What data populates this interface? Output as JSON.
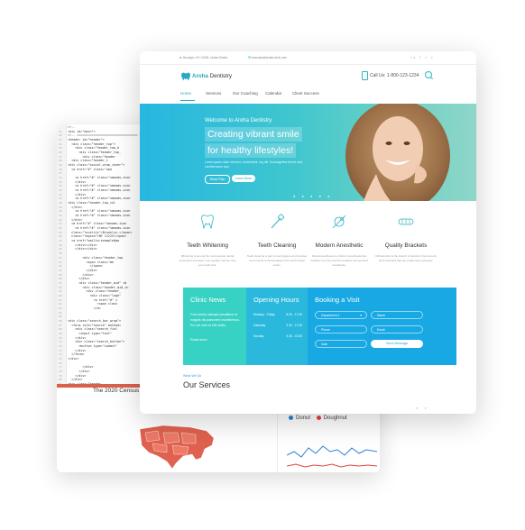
{
  "code_editor": {
    "lines": [
      {
        "n": "",
        "t": "<!--"
      },
      {
        "n": "21",
        "t": "<div id=\"main\">"
      },
      {
        "n": "22",
        "t": "<!-- ================================= Sta"
      },
      {
        "n": "23",
        "t": "<header id=\"header\">"
      },
      {
        "n": "24",
        "t": "  <div class=\"header_top\">"
      },
      {
        "n": "25",
        "t": "    <div class=\"header_top_b"
      },
      {
        "n": "26",
        "t": "      <div class=\"header_top_"
      },
      {
        "n": "27",
        "t": "        <div class=\"header"
      },
      {
        "n": "28",
        "t": "  <div class=\"header_t"
      },
      {
        "n": "29",
        "t": "<div class=\"social_wrap_inner\">"
      },
      {
        "n": "30",
        "t": "  <a href=\"#\" class=\"smo"
      },
      {
        "n": "31",
        "t": ""
      },
      {
        "n": "32",
        "t": "    <a href=\"#\" class=\"smooms-icon"
      },
      {
        "n": "33",
        "t": "    </div>"
      },
      {
        "n": "34",
        "t": "    <a href=\"#\" class=\"smooms-icon"
      },
      {
        "n": "35",
        "t": "    <a href=\"#\" class=\"smooms-icon"
      },
      {
        "n": "36",
        "t": "    </div>"
      },
      {
        "n": "37",
        "t": "    <a href=\"#\" class=\"smooms-icon"
      },
      {
        "n": "38",
        "t": "<div class=\"header_top_col"
      },
      {
        "n": "39",
        "t": "  </div>"
      },
      {
        "n": "40",
        "t": "    <a href=\"#\" class=\"smooms-icon"
      },
      {
        "n": "41",
        "t": "    <a href=\"#\" class=\"smooms-icon"
      },
      {
        "n": "42",
        "t": "  </div>"
      },
      {
        "n": "43",
        "t": "  <a href=\"#\" class=\"smooms-icon"
      },
      {
        "n": "44",
        "t": "    <a href=\"#\" class=\"smooms-icon"
      },
      {
        "n": "45",
        "t": "  class=\"locality\">Brooklyn,</span>"
      },
      {
        "n": "46",
        "t": "  class=\"region\">NY 11222</span>"
      },
      {
        "n": "47",
        "t": "  <a href=\"mailto:example@ma"
      },
      {
        "n": "48",
        "t": "    </div></div>"
      },
      {
        "n": "49",
        "t": "    </div></div>"
      },
      {
        "n": "50",
        "t": ""
      },
      {
        "n": "51",
        "t": "        <div class=\"header_top"
      },
      {
        "n": "52",
        "t": "          <span class=\"me"
      },
      {
        "n": "53",
        "t": "            </span>"
      },
      {
        "n": "54",
        "t": "          </div>"
      },
      {
        "n": "55",
        "t": "        </div>"
      },
      {
        "n": "56",
        "t": "      </div>"
      },
      {
        "n": "57",
        "t": "      <div class=\"header_mid\" id"
      },
      {
        "n": "58",
        "t": "        <div class=\"header_mid_in"
      },
      {
        "n": "59",
        "t": "          <div class=\"header_"
      },
      {
        "n": "60",
        "t": "            <div class=\"logo\""
      },
      {
        "n": "61",
        "t": "              <a href=\"#\" c"
      },
      {
        "n": "62",
        "t": "                <span class"
      },
      {
        "n": "63",
        "t": "              </a>"
      },
      {
        "n": "64",
        "t": ""
      },
      {
        "n": "65",
        "t": ""
      },
      {
        "n": "66",
        "t": "<div class=\"search_bar_wrap\">"
      },
      {
        "n": "67",
        "t": "  <form role=\"search\" method="
      },
      {
        "n": "68",
        "t": "    <div class=\"search_fiel"
      },
      {
        "n": "69",
        "t": "      <input type=\"text\""
      },
      {
        "n": "70",
        "t": "    </div>"
      },
      {
        "n": "71",
        "t": "    <div class=\"search_button\">"
      },
      {
        "n": "72",
        "t": "      <button type=\"submit\""
      },
      {
        "n": "73",
        "t": "    </div>"
      },
      {
        "n": "74",
        "t": "  </form>"
      },
      {
        "n": "75",
        "t": "</div>"
      },
      {
        "n": "76",
        "t": ""
      },
      {
        "n": "77",
        "t": "        </div>"
      },
      {
        "n": "78",
        "t": "      </div>"
      },
      {
        "n": "79",
        "t": "    </div>"
      },
      {
        "n": "80",
        "t": "  </div>"
      },
      {
        "n": "81",
        "t": "<div class=\"header_"
      }
    ],
    "census_title": "The 2020 Census w",
    "legend": [
      {
        "label": "Donut",
        "color": "#2b7fd4"
      },
      {
        "label": "Doughnut",
        "color": "#e0453a"
      }
    ]
  },
  "topbar": {
    "address": "Brooklyn, NY 10036, United States",
    "email": "example@dental-clinic.com",
    "socials": "in f t v"
  },
  "brand": {
    "name_bold": "Aroha",
    "name_rest": " Dentistry"
  },
  "header": {
    "call_label": "Call Us: 1-800-123-1234"
  },
  "nav": {
    "items": [
      "Home",
      "Services",
      "Our Coaching",
      "Calendar",
      "Client Success"
    ]
  },
  "hero": {
    "welcome": "Welcome to Aroha Dentistry",
    "headline_line1": "Creating vibrant smile",
    "headline_line2": "for healthy lifestyles!",
    "subtext": "Lorem ipsum dolor sit amet, consectetur. org elit. Suscragettes but sit med conditorneum cum.",
    "btn_plans": "Read Plan",
    "btn_more": "Learn More",
    "dots": "● ● ● ● ●"
  },
  "services": [
    {
      "title": "Teeth Whitening",
      "desc": "Whitening is among the most popular dental procedures because it can greatly improve how your teeth look.",
      "icon": "tooth-icon"
    },
    {
      "title": "Teeth Cleaning",
      "desc": "Teeth cleaning is part of oral hygiene and involves the removal of dental plaque from teeth dental caries.",
      "icon": "toothbrush-icon"
    },
    {
      "title": "Modern Anesthetic",
      "desc": "Dental anesthesia is a field of anesthesia that includes not only local but sedation and general anesthesia.",
      "icon": "syringe-icon"
    },
    {
      "title": "Quality Brackets",
      "desc": "Orthodontics is the branch of dentistry that corrects teeth and jaws that are positioned improperly.",
      "icon": "brackets-icon"
    }
  ],
  "clinic_news": {
    "title": "Clinic News",
    "text": "Cum sociis natoque penatibus et magnis dis parturient montibemus. Pro vel odio et elit mollis.",
    "more": "Read more"
  },
  "opening_hours": {
    "title": "Opening Hours",
    "rows": [
      {
        "day": "Monday - Friday",
        "time": "8.00 - 17.00"
      },
      {
        "day": "Saturday",
        "time": "9.30 - 17.00"
      },
      {
        "day": "Sunday",
        "time": "9.30 - 15.00"
      }
    ]
  },
  "booking": {
    "title": "Booking a Visit",
    "department": "Department 1",
    "name": "Name",
    "phone": "Phone",
    "email": "Email",
    "date": "Date",
    "send": "Send Message"
  },
  "footer_section": {
    "what_we_do": "What We Do",
    "title": "Our Services",
    "dots": "● ●"
  }
}
